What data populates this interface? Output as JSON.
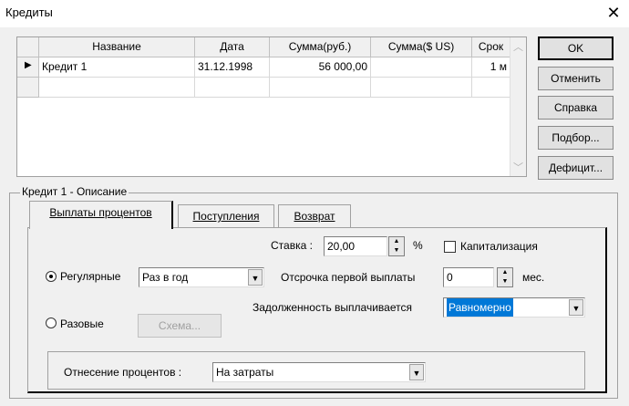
{
  "window": {
    "title": "Кредиты"
  },
  "grid": {
    "columns": [
      "Название",
      "Дата",
      "Сумма(руб.)",
      "Сумма($ US)",
      "Срок"
    ],
    "rows": [
      [
        "Кредит 1",
        "31.12.1998",
        "56 000,00",
        "",
        "1 м"
      ]
    ]
  },
  "buttons": {
    "ok": "OK",
    "cancel": "Отменить",
    "help": "Справка",
    "selection": "Подбор...",
    "deficit": "Дефицит..."
  },
  "group": {
    "label": "Кредит 1 - Описание"
  },
  "tabs": [
    "Выплаты процентов",
    "Поступления",
    "Возврат"
  ],
  "form": {
    "rate_label": "Ставка :",
    "rate_value": "20,00",
    "rate_unit": "%",
    "capitalization": "Капитализация",
    "regular": "Регулярные",
    "regular_value": "Раз в год",
    "delay_label": "Отсрочка первой выплаты",
    "delay_value": "0",
    "delay_unit": "мес.",
    "debt_label": "Задолженность выплачивается",
    "debt_value": "Равномерно",
    "onetime": "Разовые",
    "scheme": "Схема...",
    "interest_label": "Отнесение процентов :",
    "interest_value": "На затраты"
  }
}
